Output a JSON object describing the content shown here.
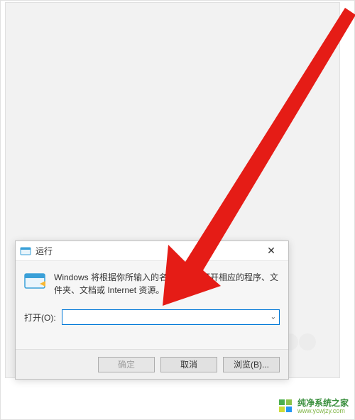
{
  "dialog": {
    "title": "运行",
    "description": "Windows 将根据你所输入的名称，为你打开相应的程序、文件夹、文档或 Internet 资源。",
    "open_label": "打开(O):",
    "input_value": "",
    "buttons": {
      "ok": "确定",
      "cancel": "取消",
      "browse": "浏览(B)..."
    }
  },
  "close_glyph": "✕",
  "combo_arrow_glyph": "⌄",
  "watermark": {
    "brand": "纯净系统之家",
    "url": "www.ycwjzy.com"
  }
}
